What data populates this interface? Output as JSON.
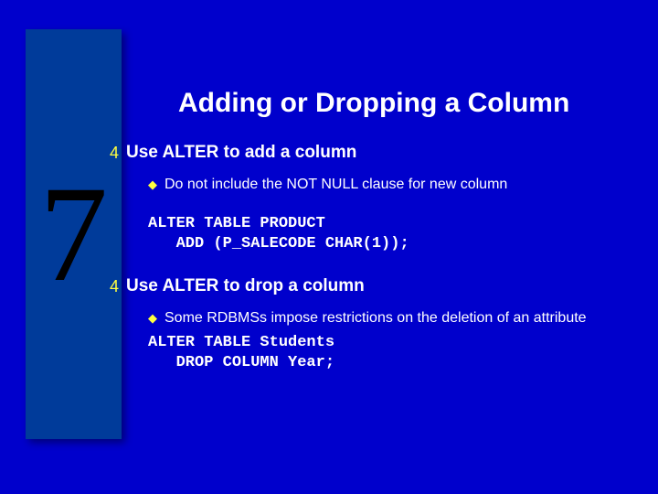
{
  "chapter": "7",
  "title": "Adding or Dropping a Column",
  "sections": [
    {
      "bullet": "Use ALTER to add a column",
      "sub": "Do not include the NOT NULL clause for new column",
      "code": "ALTER TABLE PRODUCT\n   ADD (P_SALECODE CHAR(1));"
    },
    {
      "bullet": "Use ALTER to drop a column",
      "sub": "Some RDBMSs impose restrictions on the deletion of an attribute",
      "code": "ALTER TABLE Students\n   DROP COLUMN Year;"
    }
  ]
}
